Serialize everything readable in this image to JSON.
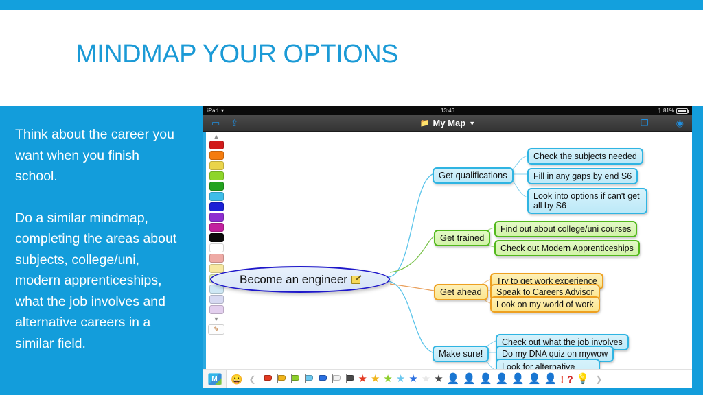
{
  "slide": {
    "title": "MINDMAP YOUR OPTIONS",
    "title_color": "#1b9ad6",
    "accent_color": "#139ddb",
    "body_paragraph_1": "Think about the career you want when you finish school.",
    "body_paragraph_2": "Do a similar mindmap, completing the areas about subjects, college/uni, modern apprenticeships, what the job involves and alternative careers in a similar field."
  },
  "ipad": {
    "status_bar": {
      "device": "iPad",
      "wifi_icon": "wifi-icon",
      "time": "13:46",
      "bluetooth_icon": "bluetooth-icon",
      "battery_percent": "81%"
    },
    "app_bar": {
      "left_icons": [
        "folders-icon",
        "export-icon"
      ],
      "document_title": "My Map",
      "folder_icon": "folder-icon",
      "caret_icon": "chevron-down-icon",
      "right_icons": [
        "present-icon",
        "settings-icon"
      ]
    },
    "palette": {
      "scroll_up_icon": "chevron-up-icon",
      "scroll_down_icon": "chevron-down-icon",
      "pen_tool_icon": "highlighter-pen-icon",
      "swatches": [
        "#d11b1b",
        "#f57c0e",
        "#ead44b",
        "#8ed52a",
        "#23a21f",
        "#3ebde8",
        "#1b21d6",
        "#8e2fd0",
        "#c2219e",
        "#0a0a0a",
        "#ffffff",
        "#eeaaa5",
        "#f7e8a1",
        "#ddf0b0",
        "#cfe8f5",
        "#d7d9f2",
        "#e3cfee"
      ]
    },
    "mindmap": {
      "central_node": {
        "label": "Become an engineer",
        "note_icon": "note-edit-icon",
        "border_color": "#1e17c9"
      },
      "branches": [
        {
          "label": "Get qualifications",
          "color": "#2fb4e2",
          "style": "blue",
          "children": [
            "Check the subjects needed",
            "Fill in any gaps by end S6",
            "Look into options if can't get all by S6"
          ]
        },
        {
          "label": "Get trained",
          "color": "#52b81c",
          "style": "green",
          "children": [
            "Find out about college/uni courses",
            "Check out Modern Apprenticeships"
          ]
        },
        {
          "label": "Get ahead",
          "color": "#eda021",
          "style": "yellow",
          "children": [
            "Try to get work experience",
            "Speak to Careers Advisor",
            "Look on my world of work"
          ]
        },
        {
          "label": "Make sure!",
          "color": "#2fb4e2",
          "style": "blue",
          "children": [
            "Check out what the job involves",
            "Do my DNA quiz on mywow",
            "Look for alternative careers which may be similar"
          ]
        }
      ]
    },
    "bottom_toolbar": {
      "app_icon": "imindmap-cube-icon",
      "app_icon_letter": "M",
      "smiley_icon": "smiley-face-icon",
      "prev_icon": "chevron-left-icon",
      "next_icon": "chevron-right-icon",
      "flags": [
        "#e33a22",
        "#f0b51c",
        "#8dce2b",
        "#6cc8ef",
        "#2b6fe0",
        "#f2f2f2",
        "#4a4a4a"
      ],
      "stars": [
        "#e33a22",
        "#f0b51c",
        "#8dce2b",
        "#6cc8ef",
        "#2b6fe0",
        "#e8e8e8",
        "#4a4a4a"
      ],
      "people": [
        "#e33a22",
        "#f0b51c",
        "#8dce2b",
        "#6cc8ef",
        "#2b6fe0",
        "#e0e0e0",
        "#4a4a4a"
      ],
      "exclamation": "!",
      "question": "?",
      "bulb_icon": "lightbulb-icon"
    }
  }
}
